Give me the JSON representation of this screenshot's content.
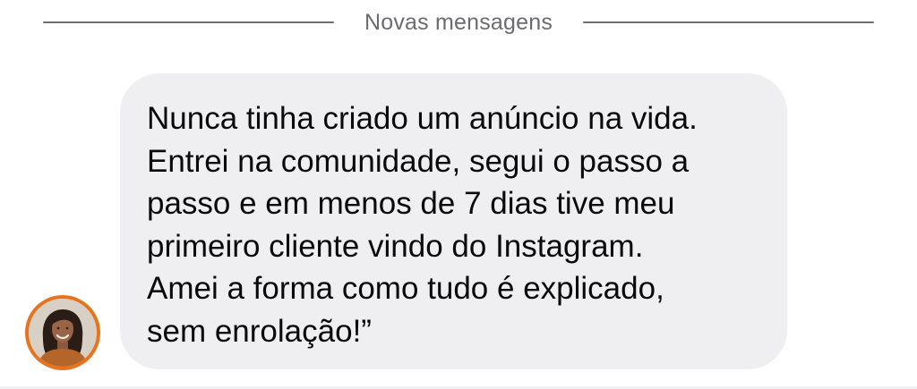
{
  "divider": {
    "label": "Novas mensagens"
  },
  "message": {
    "lines": [
      "Nunca tinha criado um anúncio na vida.",
      "Entrei na comunidade, segui o passo a",
      "passo e em menos de 7 dias tive meu",
      "primeiro cliente vindo do Instagram.",
      "Amei a forma como tudo é explicado,",
      "sem enrolação!”"
    ]
  },
  "colors": {
    "bubble_background": "#efeff2",
    "avatar_ring": "#e8731f",
    "divider_line": "#6e6e73",
    "divider_text": "#6b6b70"
  }
}
